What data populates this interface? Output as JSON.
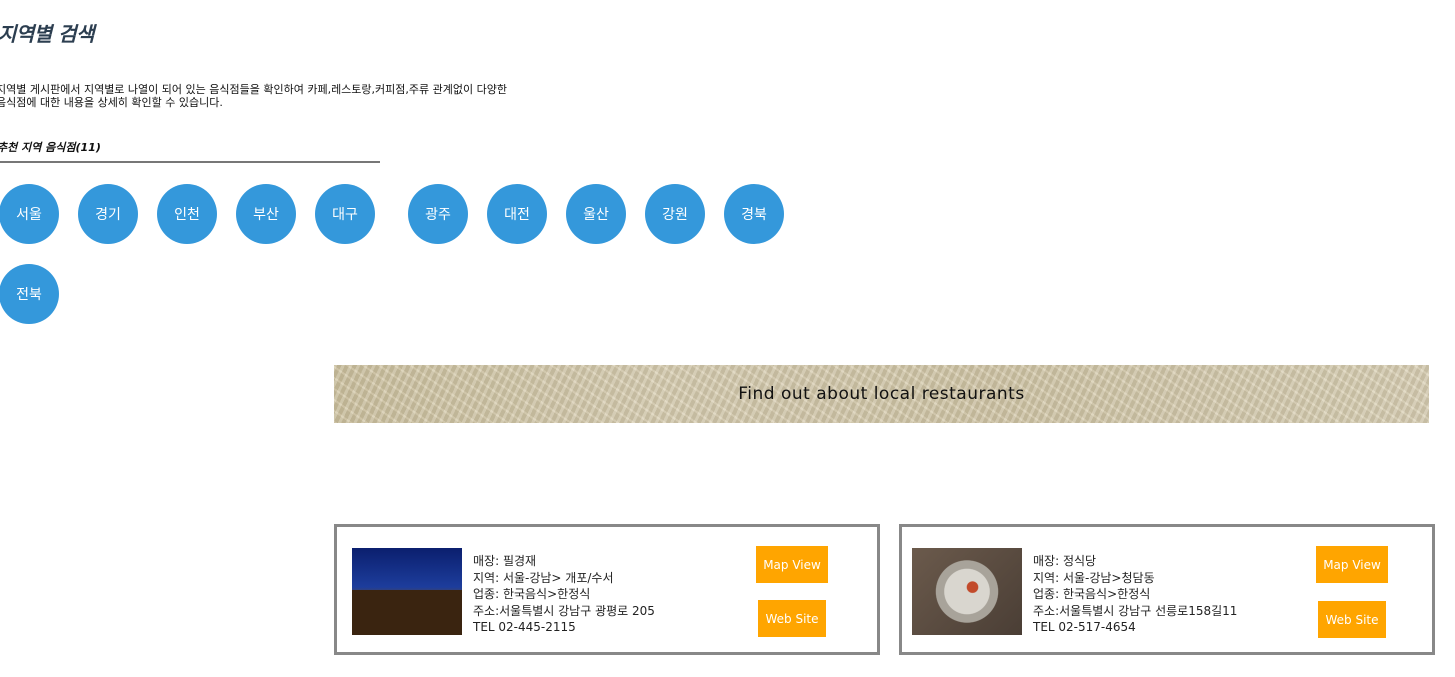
{
  "page": {
    "title": "지역별 검색",
    "intro_line1": "지역별 게시판에서 지역별로 나열이 되어 있는 음식점들을 확인하여 카페,레스토랑,커피점,주류 관계없이 다양한",
    "intro_line2": "음식점에 대한 내용을 상세히 확인할 수 있습니다."
  },
  "regions": {
    "section_title": "추천 지역 음식점(11)",
    "items": [
      "서울",
      "경기",
      "인천",
      "부산",
      "대구",
      "광주",
      "대전",
      "울산",
      "강원",
      "경북",
      "전북"
    ],
    "color": "#3498db"
  },
  "banner": {
    "text": "Find out about local restaurants"
  },
  "restaurants": [
    {
      "store": "매장: 필경재",
      "region": "지역: 서울-강남> 개포/수서",
      "category": "업종: 한국음식>한정식",
      "address": "주소:서울특별시 강남구 광평로 205",
      "tel": "TEL 02-445-2115",
      "map_label": "Map View",
      "web_label": "Web Site"
    },
    {
      "store": "매장: 정식당",
      "region": "지역: 서울-강남>청담동",
      "category": "업종: 한국음식>한정식",
      "address": "주소:서울특별시 강남구 선릉로158길11",
      "tel": "TEL 02-517-4654",
      "map_label": "Map View",
      "web_label": "Web Site"
    }
  ],
  "colors": {
    "button": "#ffa500",
    "card_border": "#888888"
  }
}
